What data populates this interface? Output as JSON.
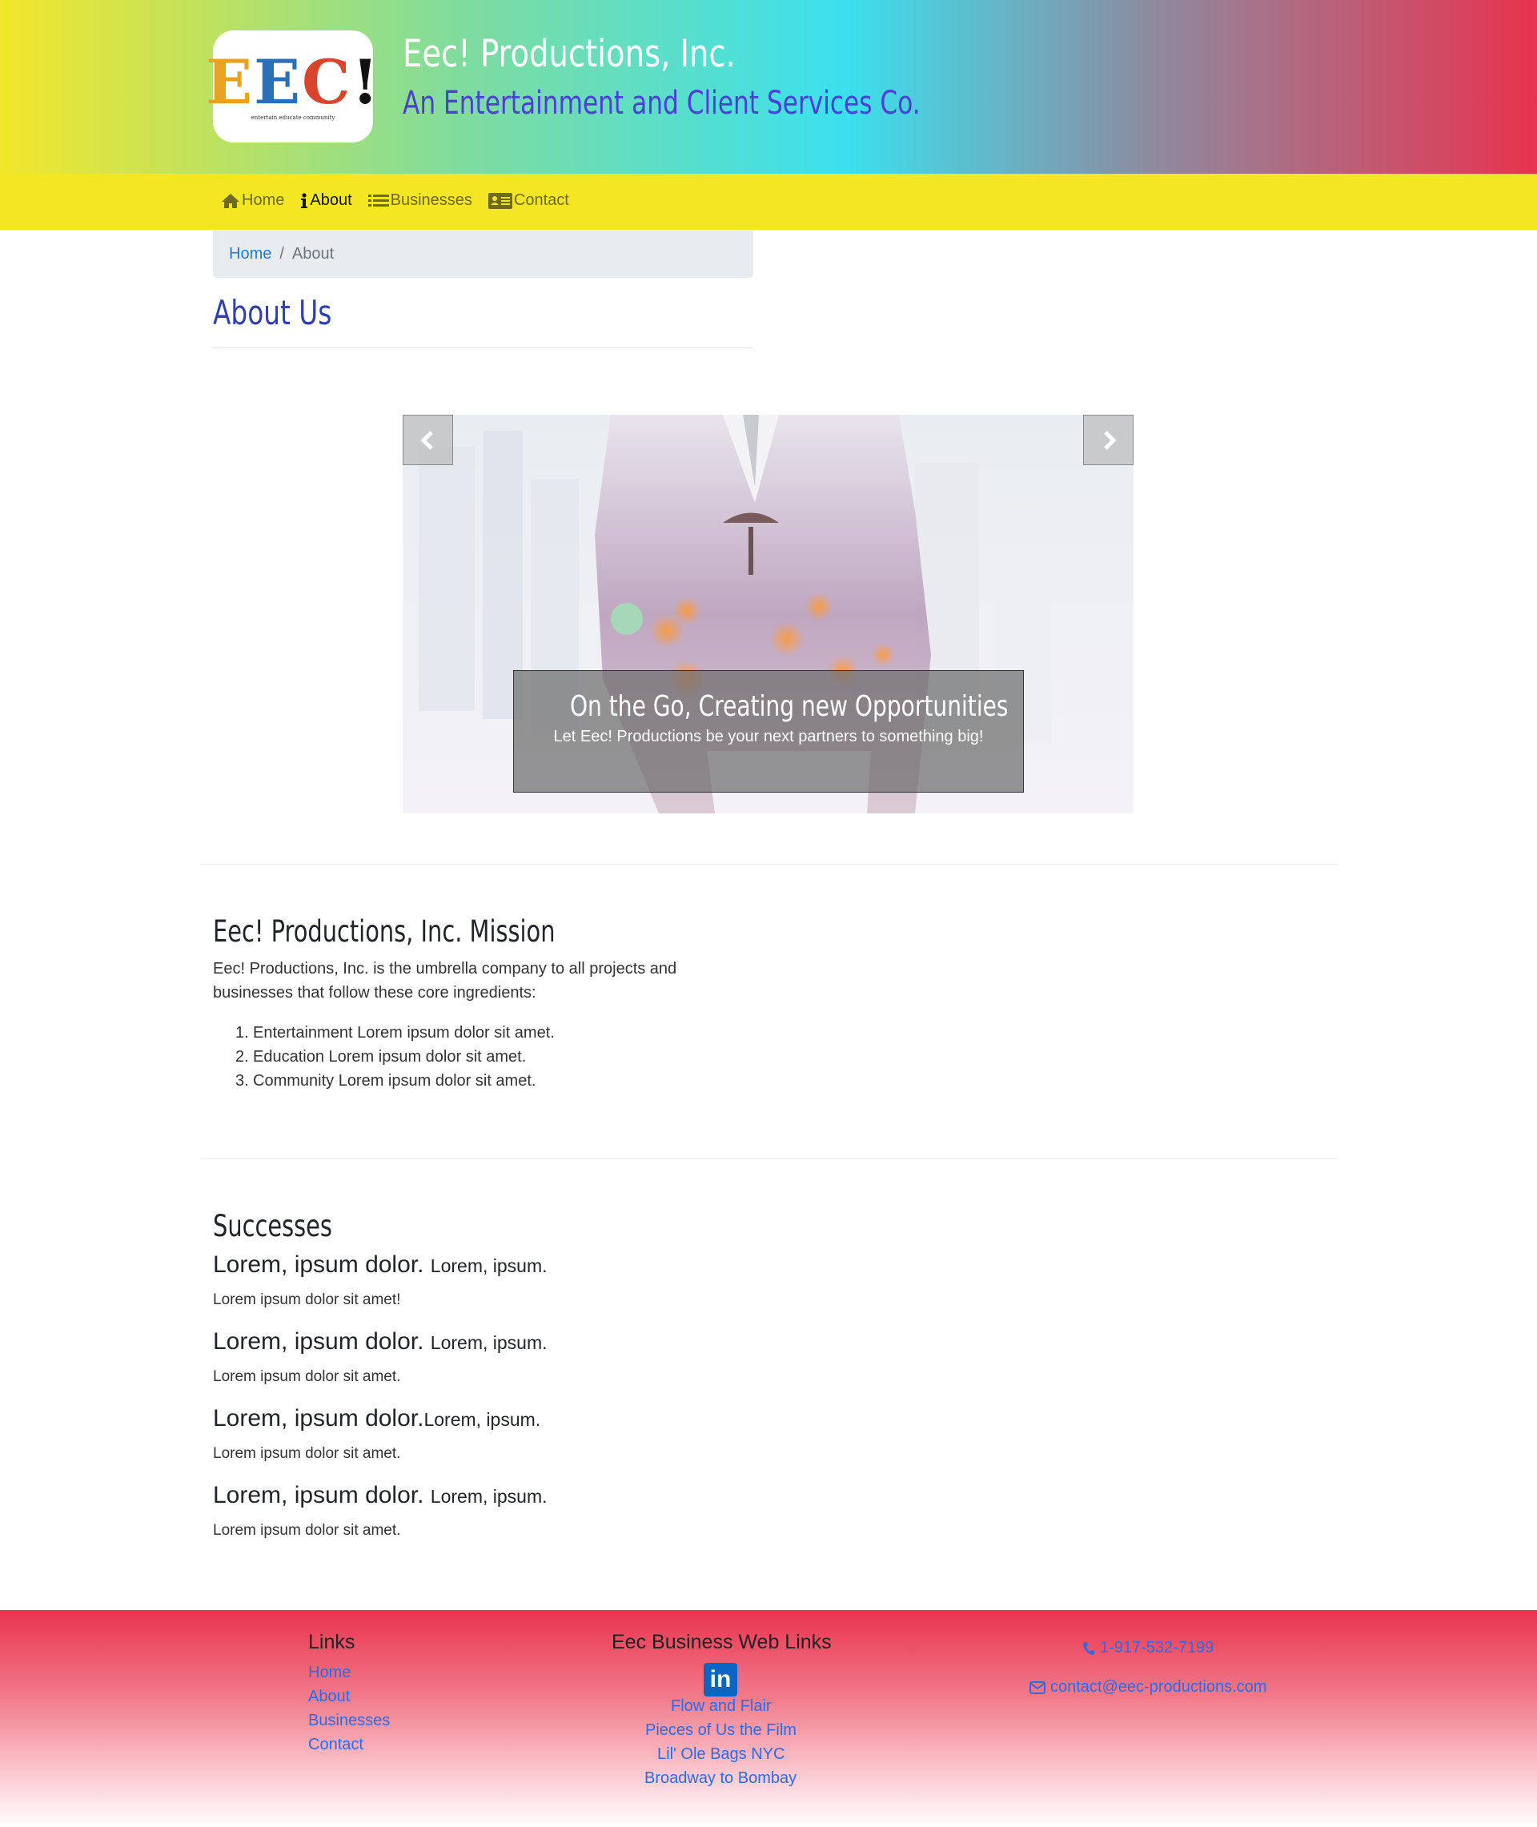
{
  "header": {
    "logo_text": "EEC!",
    "logo_tagline": "entertain educate community",
    "title": "Eec! Productions, Inc.",
    "subtitle": "An Entertainment and Client Services Co."
  },
  "nav": {
    "items": [
      {
        "label": "Home",
        "icon": "home-icon"
      },
      {
        "label": "About",
        "icon": "info-icon"
      },
      {
        "label": "Businesses",
        "icon": "list-icon"
      },
      {
        "label": "Contact",
        "icon": "contact-card-icon"
      }
    ],
    "active": "About"
  },
  "breadcrumb": {
    "home": "Home",
    "separator": "/",
    "current": "About"
  },
  "page": {
    "title": "About Us"
  },
  "carousel": {
    "caption_title": "On the Go, Creating new Opportunities",
    "caption_text": "Let Eec! Productions be your next partners to something big!"
  },
  "mission": {
    "heading": "Eec! Productions, Inc. Mission",
    "text": "Eec! Productions, Inc. is the umbrella company to all projects and businesses that follow these core ingredients:",
    "items": [
      "Entertainment Lorem ipsum dolor sit amet.",
      "Education Lorem ipsum dolor sit amet.",
      "Community Lorem ipsum dolor sit amet."
    ]
  },
  "successes": {
    "heading": "Successes",
    "items": [
      {
        "big": "Lorem, ipsum dolor. ",
        "small": "Lorem, ipsum.",
        "desc": "Lorem ipsum dolor sit amet!"
      },
      {
        "big": "Lorem, ipsum dolor. ",
        "small": "Lorem, ipsum.",
        "desc": "Lorem ipsum dolor sit amet."
      },
      {
        "big": "Lorem, ipsum dolor.",
        "small": "Lorem, ipsum.",
        "desc": "Lorem ipsum dolor sit amet."
      },
      {
        "big": "Lorem, ipsum dolor. ",
        "small": "Lorem, ipsum.",
        "desc": "Lorem ipsum dolor sit amet."
      }
    ]
  },
  "footer": {
    "links_heading": "Links",
    "links": [
      "Home",
      "About",
      "Businesses",
      "Contact"
    ],
    "web_heading": "Eec Business Web Links",
    "linkedin_label": "in",
    "web_links": [
      "Flow and Flair",
      "Pieces of Us the Film",
      "Lil' Ole Bags NYC",
      "Broadway to Bombay"
    ],
    "phone": "1-917-532-7199",
    "email": "contact@eec-productions.com"
  },
  "colors": {
    "brand_yellow": "#f2e722",
    "brand_red": "#e8344f",
    "title_blue": "#2f3fb0",
    "link_blue": "#2f6ae6"
  }
}
